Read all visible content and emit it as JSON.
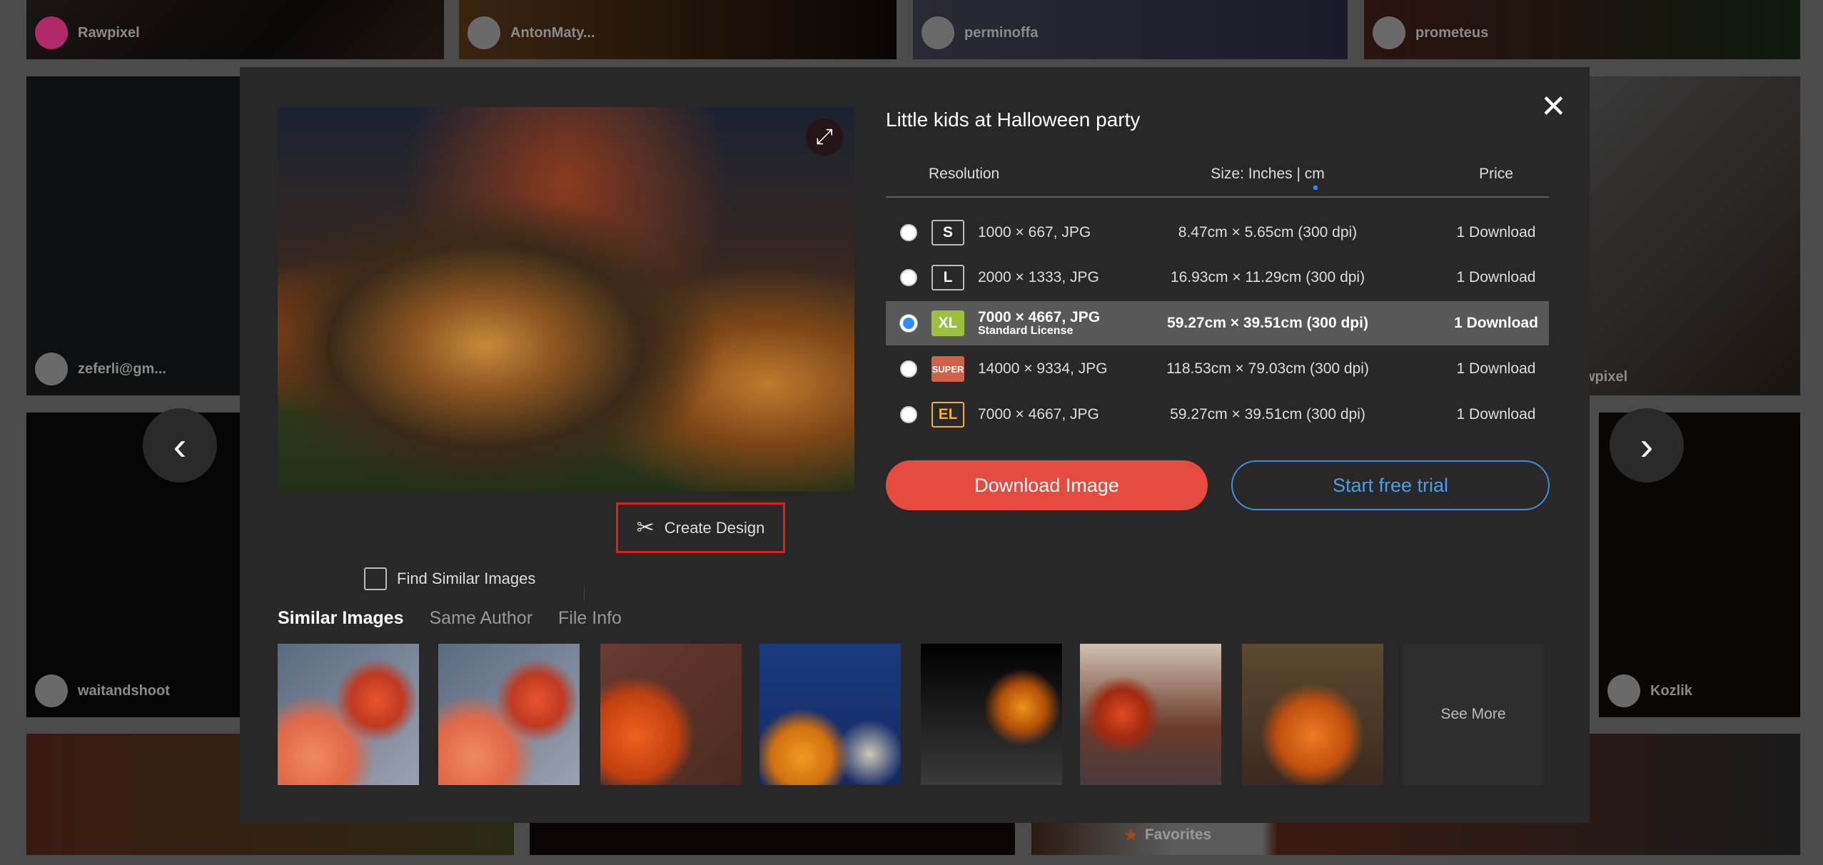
{
  "background": {
    "authors": [
      "Rawpixel",
      "AntonMaty...",
      "perminoffa",
      "prometeus",
      "zeferli@gm...",
      "wpixel",
      "waitandshoot",
      "Kozlik"
    ],
    "favorites_label": "Favorites"
  },
  "modal": {
    "title": "Little kids at Halloween party",
    "close_icon": "close-icon",
    "table": {
      "headers": {
        "resolution": "Resolution",
        "size": "Size: Inches | cm",
        "price": "Price"
      },
      "rows": [
        {
          "badge": "S",
          "resolution": "1000 × 667, JPG",
          "license": "",
          "size": "8.47cm × 5.65cm (300 dpi)",
          "price": "1 Download",
          "selected": false,
          "badge_color": "#282828"
        },
        {
          "badge": "L",
          "resolution": "2000 × 1333, JPG",
          "license": "",
          "size": "16.93cm × 11.29cm (300 dpi)",
          "price": "1 Download",
          "selected": false,
          "badge_color": "#282828"
        },
        {
          "badge": "XL",
          "resolution": "7000 × 4667, JPG",
          "license": "Standard License",
          "size": "59.27cm × 39.51cm (300 dpi)",
          "price": "1 Download",
          "selected": true,
          "badge_color": "#9bc03f"
        },
        {
          "badge": "SUPER",
          "resolution": "14000 × 9334, JPG",
          "license": "",
          "size": "118.53cm × 79.03cm (300 dpi)",
          "price": "1 Download",
          "selected": false,
          "badge_color": "#d0624a"
        },
        {
          "badge": "EL",
          "resolution": "7000 × 4667, JPG",
          "license": "",
          "size": "59.27cm × 39.51cm (300 dpi)",
          "price": "1 Download",
          "selected": false,
          "badge_color": "#282828"
        }
      ]
    },
    "download_button": "Download Image",
    "trial_button": "Start free trial",
    "find_similar": "Find Similar Images",
    "create_design": "Create Design",
    "tabs": [
      "Similar Images",
      "Same Author",
      "File Info"
    ],
    "see_more": "See More",
    "colors": {
      "download": "#e64b3f",
      "trial": "#3a8fe0",
      "highlight": "#e02020"
    }
  }
}
